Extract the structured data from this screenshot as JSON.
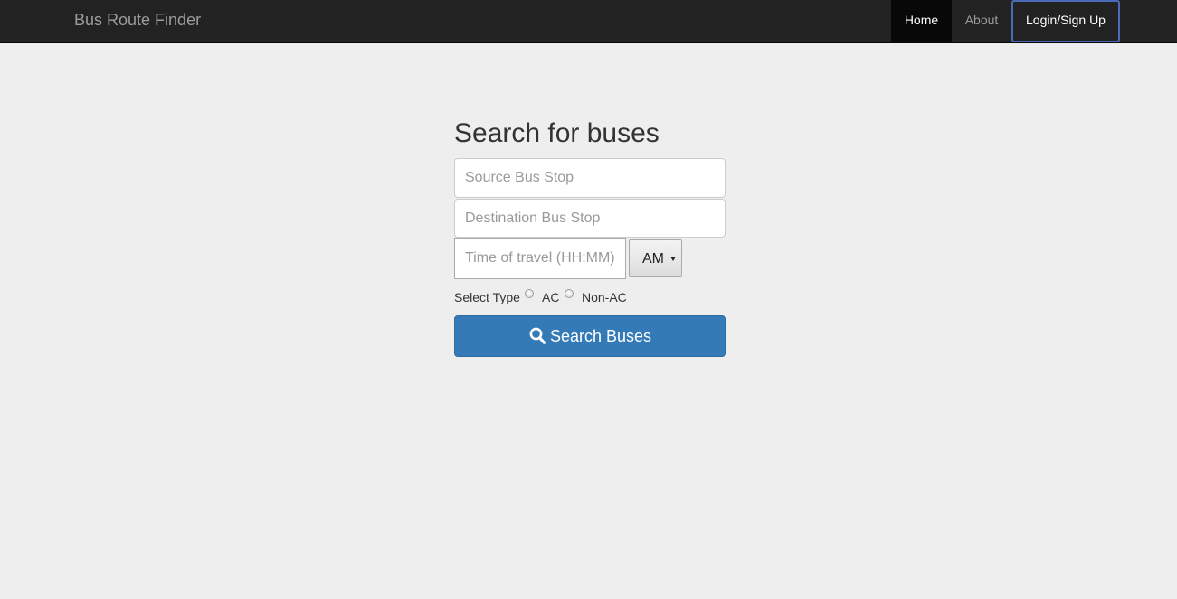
{
  "navbar": {
    "brand": "Bus Route Finder",
    "items": [
      {
        "label": "Home",
        "active": true
      },
      {
        "label": "About",
        "active": false
      },
      {
        "label": "Login/Sign Up",
        "active": false
      }
    ]
  },
  "search": {
    "heading": "Search for buses",
    "source_placeholder": "Source Bus Stop",
    "destination_placeholder": "Destination Bus Stop",
    "time_placeholder": "Time of travel (HH:MM)",
    "period_selected": "AM",
    "type_label": "Select Type",
    "type_options": [
      "AC",
      "Non-AC"
    ],
    "button_label": "Search Buses",
    "button_icon": "search-icon"
  },
  "colors": {
    "navbar_bg": "#222222",
    "page_bg": "#eeeeee",
    "primary": "#337ab7",
    "login_border": "#4a6ab8"
  }
}
